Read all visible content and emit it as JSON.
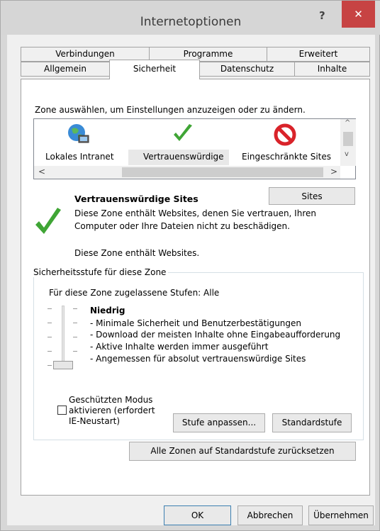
{
  "window": {
    "title": "Internetoptionen",
    "help_label": "?",
    "close_label": "✕"
  },
  "tabs_row1": [
    "Verbindungen",
    "Programme",
    "Erweitert"
  ],
  "tabs_row2": [
    "Allgemein",
    "Sicherheit",
    "Datenschutz",
    "Inhalte"
  ],
  "active_tab": "Sicherheit",
  "zone_prompt": "Zone auswählen, um Einstellungen anzuzeigen oder zu ändern.",
  "zones": [
    {
      "label": "Lokales Intranet",
      "icon": "globe-computer-icon"
    },
    {
      "label": "Vertrauenswürdige",
      "icon": "green-check-icon",
      "selected": true
    },
    {
      "label": "Eingeschränkte Sites",
      "icon": "red-restricted-icon"
    }
  ],
  "sites_button": "Sites",
  "zone_info": {
    "title": "Vertrauenswürdige Sites",
    "desc_line1": "Diese Zone enthält Websites, denen Sie vertrauen, Ihren",
    "desc_line2": "Computer oder Ihre Dateien nicht zu beschädigen.",
    "contains": "Diese Zone enthält Websites."
  },
  "security_group": {
    "legend": "Sicherheitsstufe für diese Zone",
    "allowed_levels": "Für diese Zone zugelassene Stufen: Alle",
    "level_name": "Niedrig",
    "level_items": [
      "- Minimale Sicherheit und Benutzerbestätigungen",
      "- Download der meisten Inhalte ohne Eingabeaufforderung",
      "- Aktive Inhalte werden immer ausgeführt",
      "- Angemessen für absolut vertrauenswürdige Sites"
    ],
    "protected_mode_line1": "Geschützten Modus",
    "protected_mode_line2": "aktivieren (erfordert",
    "protected_mode_line3": "IE-Neustart)",
    "custom_level_button": "Stufe anpassen...",
    "default_level_button": "Standardstufe"
  },
  "reset_all_button": "Alle Zonen auf Standardstufe zurücksetzen",
  "footer": {
    "ok": "OK",
    "cancel": "Abbrechen",
    "apply": "Übernehmen"
  }
}
